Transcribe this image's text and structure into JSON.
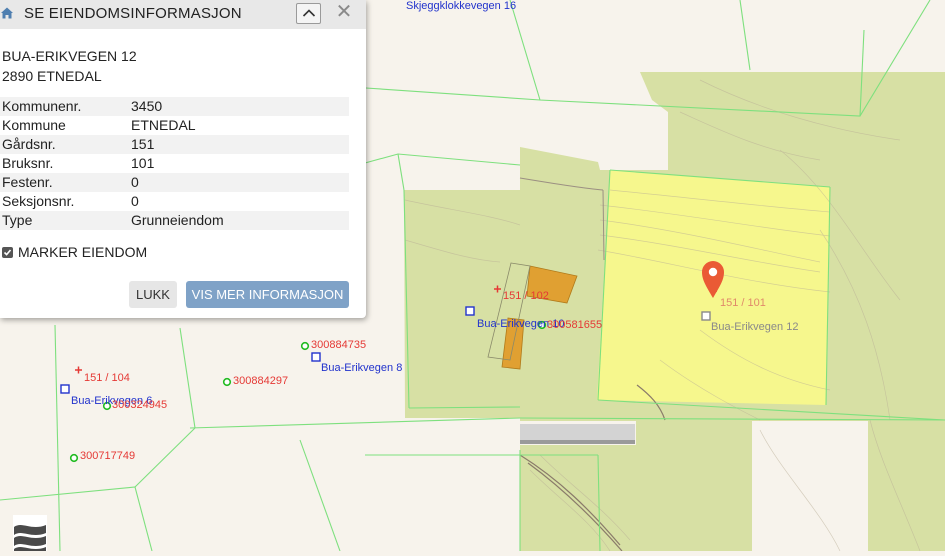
{
  "panel": {
    "title": "SE EIENDOMSINFORMASJON",
    "address_line1": "BUA-ERIKVEGEN 12",
    "address_line2": "2890 ETNEDAL",
    "fields": [
      {
        "label": "Kommunenr.",
        "value": "3450"
      },
      {
        "label": "Kommune",
        "value": "ETNEDAL"
      },
      {
        "label": "Gårdsnr.",
        "value": "151"
      },
      {
        "label": "Bruksnr.",
        "value": "101"
      },
      {
        "label": "Festenr.",
        "value": "0"
      },
      {
        "label": "Seksjonsnr.",
        "value": "0"
      },
      {
        "label": "Type",
        "value": "Grunneiendom"
      }
    ],
    "marker_label": "MARKER EIENDOM",
    "marker_checked": true,
    "close_label": "LUKK",
    "more_info_label": "VIS MER INFORMASJON"
  },
  "map": {
    "road_labels": {
      "top": "Skjeggklokkevegen 16",
      "bua8": "Bua-Erikvegen 8",
      "bua10": "Bua-Erikvegen 10",
      "bua6": "Bua-Erikvegen 6",
      "bua12": "Bua-Erikvegen 12"
    },
    "parcel_labels": {
      "p151_102": "151 / 102",
      "p151_104": "151 / 104",
      "p151_101": "151 / 101"
    },
    "point_labels": {
      "p300884735": "300884735",
      "p300884297": "300884297",
      "p300581655": "300581655",
      "p300324945": "300324945",
      "p300717749": "300717749"
    },
    "colors": {
      "background": "#f7f3ec",
      "forest": "#d7e0a4",
      "selected": "#fbf98a",
      "border": "#7ee07e",
      "building": "#e0a032",
      "pin": "#ea5a35",
      "parcel_label": "#e53935",
      "address_label": "#2233cc"
    }
  }
}
